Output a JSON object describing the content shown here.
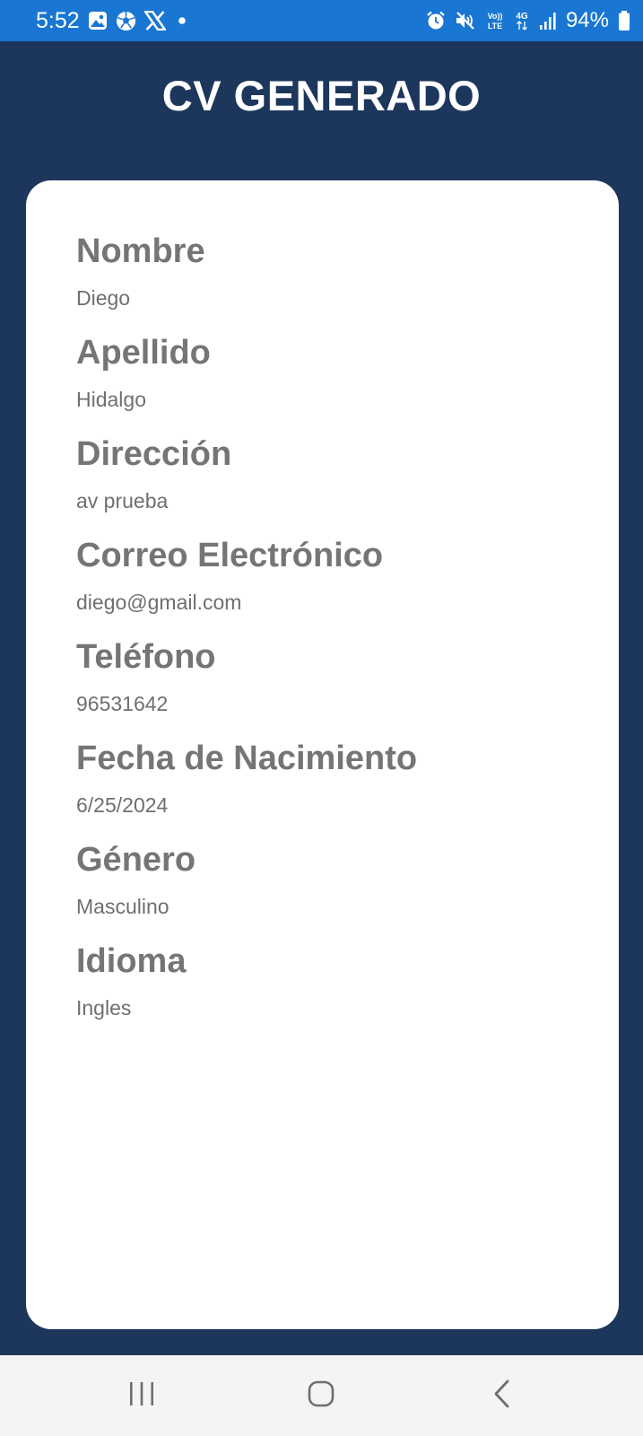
{
  "status_bar": {
    "time": "5:52",
    "battery": "94%",
    "left_icons": [
      "gallery-icon",
      "soccer-ball-icon",
      "x-logo-icon",
      "notification-dot-icon"
    ],
    "right_icons": [
      "alarm-icon",
      "mute-icon",
      "volte-icon",
      "4g-icon",
      "signal-icon",
      "battery-icon"
    ],
    "volte_label": "Vo)) LTE",
    "network_label": "4G"
  },
  "header": {
    "title": "CV GENERADO"
  },
  "cv": {
    "fields": [
      {
        "label": "Nombre",
        "value": "Diego"
      },
      {
        "label": "Apellido",
        "value": "Hidalgo"
      },
      {
        "label": "Dirección",
        "value": "av prueba"
      },
      {
        "label": "Correo Electrónico",
        "value": "diego@gmail.com"
      },
      {
        "label": "Teléfono",
        "value": "96531642"
      },
      {
        "label": "Fecha de Nacimiento",
        "value": "6/25/2024"
      },
      {
        "label": "Género",
        "value": "Masculino"
      },
      {
        "label": "Idioma",
        "value": "Ingles"
      }
    ]
  },
  "nav_bar": {
    "buttons": [
      "recent-apps-icon",
      "home-icon",
      "back-icon"
    ]
  },
  "colors": {
    "status_bar": "#1976d2",
    "background": "#1d365c",
    "card": "#ffffff",
    "label": "#757575",
    "value": "#6f6f6f",
    "nav_bar": "#f4f4f4"
  }
}
